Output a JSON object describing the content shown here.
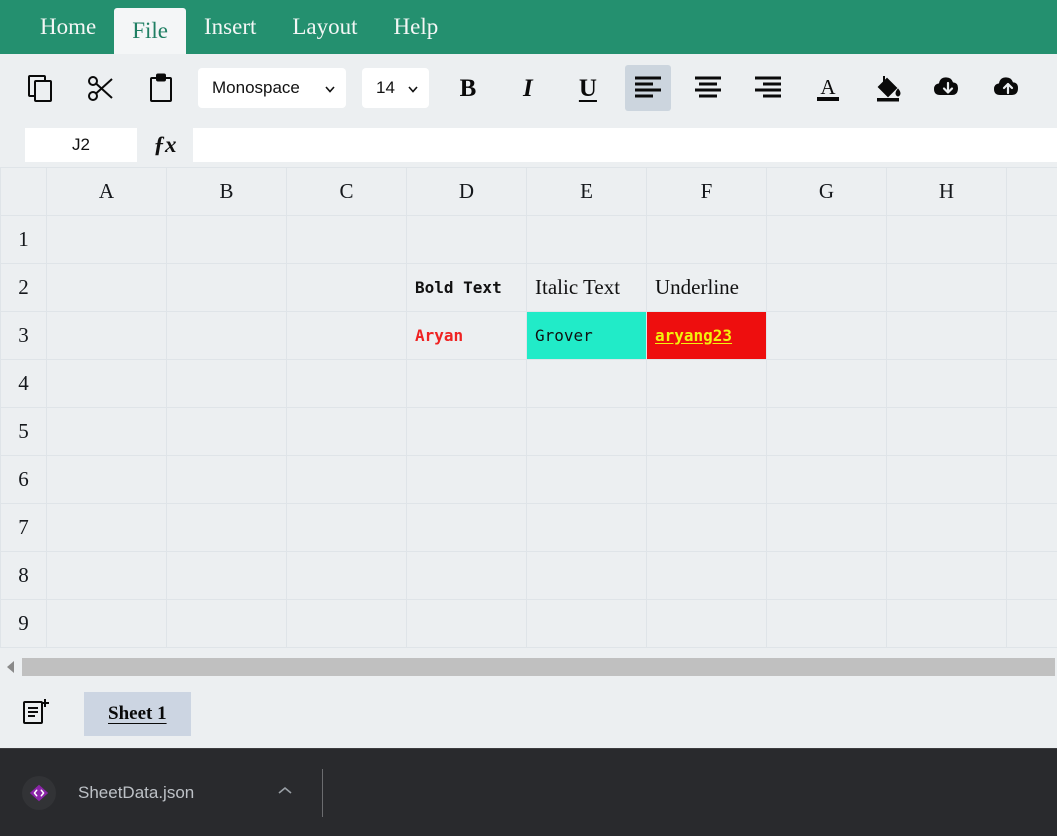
{
  "menubar": {
    "items": [
      {
        "label": "Home",
        "active": false
      },
      {
        "label": "File",
        "active": true
      },
      {
        "label": "Insert",
        "active": false
      },
      {
        "label": "Layout",
        "active": false
      },
      {
        "label": "Help",
        "active": false
      }
    ],
    "background_color": "#24906f",
    "active_tab_color": "#1f7f63"
  },
  "toolbar": {
    "copy_icon": "copy-icon",
    "cut_icon": "cut-icon",
    "paste_icon": "paste-icon",
    "font_family_value": "Monospace",
    "font_size_value": "14",
    "bold_label": "B",
    "italic_label": "I",
    "underline_label": "U",
    "align_left_icon": "align-left-icon",
    "align_center_icon": "align-center-icon",
    "align_right_icon": "align-right-icon",
    "text_color_icon": "text-color-icon",
    "fill_color_icon": "fill-color-icon",
    "download_icon": "cloud-download-icon",
    "upload_icon": "cloud-upload-icon",
    "active_button": "align-left",
    "active_highlight_color": "#ccd5de"
  },
  "formula_bar": {
    "cell_reference": "J2",
    "fx_label": "ƒx",
    "formula_value": "",
    "formula_placeholder": ""
  },
  "grid": {
    "columns": [
      "A",
      "B",
      "C",
      "D",
      "E",
      "F",
      "G",
      "H"
    ],
    "rows": [
      "1",
      "2",
      "3",
      "4",
      "5",
      "6",
      "7",
      "8",
      "9"
    ],
    "cells": {
      "D2": {
        "text": "Bold Text",
        "font": "mono",
        "bold": true,
        "italic": false,
        "underline": false,
        "color": "#111111",
        "background": ""
      },
      "E2": {
        "text": "Italic Text",
        "font": "serif",
        "bold": false,
        "italic": false,
        "underline": false,
        "color": "#111111",
        "background": ""
      },
      "F2": {
        "text": "Underline",
        "font": "serif",
        "bold": false,
        "italic": false,
        "underline": false,
        "color": "#111111",
        "background": ""
      },
      "D3": {
        "text": "Aryan",
        "font": "mono",
        "bold": true,
        "italic": false,
        "underline": false,
        "color": "#ef2222",
        "background": ""
      },
      "E3": {
        "text": "Grover",
        "font": "mono",
        "bold": false,
        "italic": false,
        "underline": false,
        "color": "#111111",
        "background": "#21ebc8"
      },
      "F3": {
        "text": "aryang23",
        "font": "mono",
        "bold": true,
        "italic": false,
        "underline": true,
        "color": "#f2f20c",
        "background": "#ee0e0e"
      }
    }
  },
  "scrollbar": {
    "left_arrow_icon": "chevron-left-icon",
    "track_color": "#c0c0c0"
  },
  "sheetbar": {
    "add_sheet_icon": "add-sheet-icon",
    "tabs": [
      {
        "label": "Sheet 1",
        "active": true
      }
    ]
  },
  "download_bar": {
    "file_icon": "json-file-icon",
    "file_name": "SheetData.json",
    "caret_icon": "chevron-up-icon",
    "background_color": "#292a2d",
    "icon_color": "#8b24a8"
  }
}
